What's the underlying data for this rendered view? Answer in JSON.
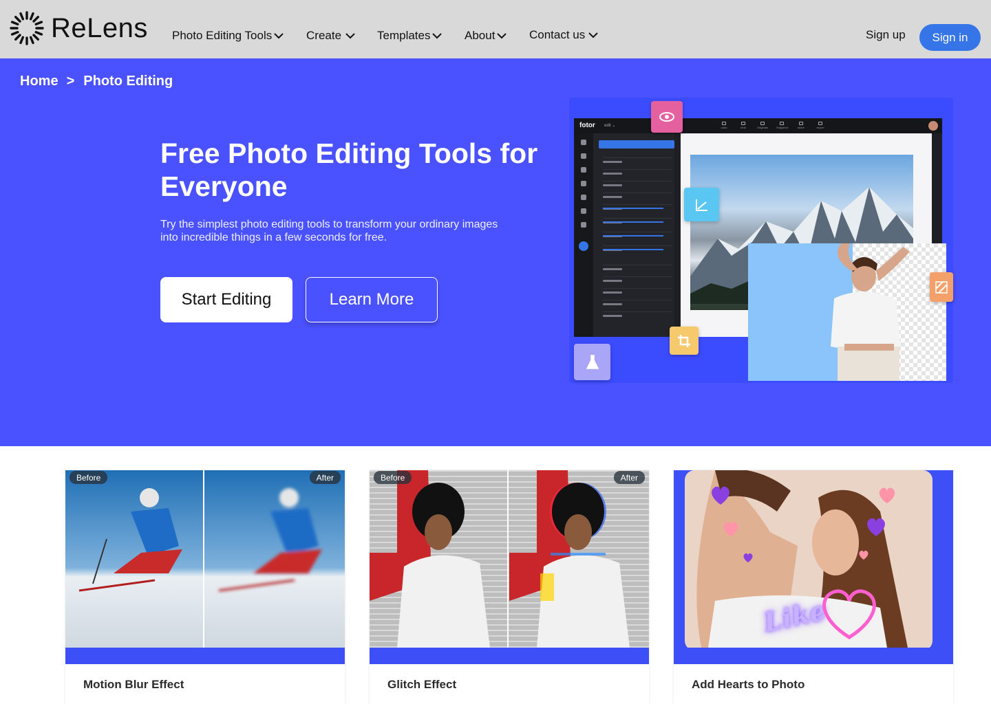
{
  "brand": {
    "name": "ReLens",
    "logo_icon": "sunburst-logo-icon"
  },
  "nav": {
    "items": [
      {
        "label": "Photo Editing Tools"
      },
      {
        "label": "Create"
      },
      {
        "label": "Templates"
      },
      {
        "label": "About"
      },
      {
        "label": "Contact us"
      }
    ],
    "signup_label": "Sign up",
    "signin_label": "Sign in"
  },
  "breadcrumb": {
    "home": "Home",
    "separator": ">",
    "current": "Photo Editing"
  },
  "hero": {
    "title": "Free Photo Editing Tools for Everyone",
    "subtitle": "Try the simplest photo editing tools to transform your ordinary images into incredible things in a few seconds for free.",
    "primary_cta": "Start Editing",
    "secondary_cta": "Learn More"
  },
  "editor_mock": {
    "logo": "fotor",
    "mode": "edit ⌄",
    "toolbar": [
      "undo",
      "redo",
      "Originals",
      "Snapshot",
      "share",
      "export"
    ]
  },
  "cards": [
    {
      "title": "Motion Blur Effect",
      "before_label": "Before",
      "after_label": "After"
    },
    {
      "title": "Glitch Effect",
      "before_label": "Before",
      "after_label": "After"
    },
    {
      "title": "Add Hearts to Photo",
      "overlay_text": "Like"
    }
  ],
  "colors": {
    "header_bg": "#d9d9d9",
    "hero_bg": "#4a51fe",
    "signin_bg": "#3575e8",
    "card_band": "#3d4ff7"
  }
}
